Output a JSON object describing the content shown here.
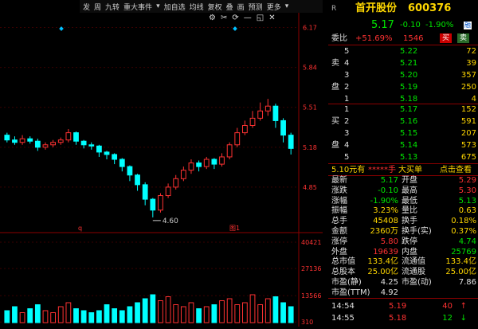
{
  "toolbar": {
    "items": [
      "发",
      "周",
      "九转",
      "重大事件",
      "▾",
      "加自选",
      "均线",
      "复权",
      "叠",
      "画",
      "预测",
      "更多",
      "▾"
    ],
    "icons": [
      "gear-icon",
      "scissors-icon",
      "refresh-icon",
      "minus-icon",
      "window-icon",
      "close-icon"
    ]
  },
  "chart": {
    "price_labels": [
      "6.17",
      "5.84",
      "5.51",
      "5.18",
      "4.85"
    ],
    "volume_labels": [
      "40421",
      "27136",
      "13566",
      "310"
    ],
    "low_label": "4.60",
    "markers": [
      "q",
      "图1"
    ]
  },
  "chart_data": {
    "type": "candlestick",
    "ylim": [
      4.52,
      6.2
    ],
    "candles": [
      [
        5.28,
        5.24,
        5.3,
        5.22
      ],
      [
        5.24,
        5.22,
        5.27,
        5.2
      ],
      [
        5.22,
        5.25,
        5.28,
        5.2
      ],
      [
        5.25,
        5.23,
        5.27,
        5.21
      ],
      [
        5.23,
        5.18,
        5.25,
        5.15
      ],
      [
        5.18,
        5.2,
        5.22,
        5.16
      ],
      [
        5.2,
        5.22,
        5.24,
        5.18
      ],
      [
        5.22,
        5.24,
        5.26,
        5.2
      ],
      [
        5.24,
        5.3,
        5.33,
        5.22
      ],
      [
        5.3,
        5.23,
        5.31,
        5.2
      ],
      [
        5.23,
        5.2,
        5.24,
        5.17
      ],
      [
        5.2,
        5.19,
        5.22,
        5.16
      ],
      [
        5.19,
        5.14,
        5.2,
        5.1
      ],
      [
        5.14,
        5.12,
        5.15,
        5.08
      ],
      [
        5.12,
        5.08,
        5.13,
        5.04
      ],
      [
        5.08,
        5.02,
        5.09,
        4.98
      ],
      [
        5.02,
        4.95,
        5.03,
        4.9
      ],
      [
        4.95,
        4.87,
        4.96,
        4.82
      ],
      [
        4.87,
        4.75,
        4.89,
        4.7
      ],
      [
        4.75,
        4.66,
        4.76,
        4.6
      ],
      [
        4.66,
        4.78,
        4.8,
        4.64
      ],
      [
        4.78,
        4.85,
        4.88,
        4.76
      ],
      [
        4.85,
        4.92,
        4.95,
        4.83
      ],
      [
        4.92,
        4.99,
        5.02,
        4.9
      ],
      [
        4.99,
        5.05,
        5.08,
        4.96
      ],
      [
        5.05,
        5.02,
        5.07,
        4.98
      ],
      [
        5.02,
        5.08,
        5.1,
        5.0
      ],
      [
        5.08,
        5.04,
        5.09,
        5.0
      ],
      [
        5.04,
        5.1,
        5.13,
        5.02
      ],
      [
        5.1,
        5.2,
        5.22,
        5.08
      ],
      [
        5.2,
        5.3,
        5.34,
        5.18
      ],
      [
        5.3,
        5.36,
        5.4,
        5.28
      ],
      [
        5.36,
        5.42,
        5.48,
        5.34
      ],
      [
        5.42,
        5.48,
        5.55,
        5.4
      ],
      [
        5.48,
        5.52,
        5.58,
        5.44
      ],
      [
        5.52,
        5.4,
        5.54,
        5.34
      ],
      [
        5.4,
        5.28,
        5.42,
        5.22
      ],
      [
        5.28,
        5.17,
        5.3,
        5.12
      ]
    ],
    "volumes": [
      6000,
      8000,
      5000,
      7000,
      9000,
      6000,
      5000,
      8000,
      10000,
      7000,
      6000,
      5000,
      6000,
      9000,
      7000,
      6000,
      8000,
      10000,
      12000,
      14000,
      11000,
      13000,
      9000,
      8000,
      10000,
      7000,
      8000,
      9000,
      11000,
      12000,
      9000,
      10000,
      14000,
      9000,
      12000,
      13000,
      10000,
      8000
    ],
    "vol_ylim": [
      0,
      42000
    ]
  },
  "quote": {
    "logo": "R",
    "name": "首开股份",
    "code": "600376",
    "price": "5.17",
    "change": "-0.10",
    "change_pct": "-1.90%",
    "badge": "融",
    "weibi_label": "委比",
    "weibi_value": "+51.69%",
    "weicha_value": "1546",
    "sell_btn": "买",
    "buy_btn": "卖"
  },
  "orderbook": {
    "sell": [
      {
        "level": "5",
        "price": "5.22",
        "vol": "72"
      },
      {
        "level": "4",
        "price": "5.21",
        "vol": "39"
      },
      {
        "level": "3",
        "price": "5.20",
        "vol": "357"
      },
      {
        "level": "2",
        "price": "5.19",
        "vol": "250"
      },
      {
        "level": "1",
        "price": "5.18",
        "vol": "4"
      }
    ],
    "sell_chars": [
      "卖",
      "盘"
    ],
    "buy": [
      {
        "level": "1",
        "price": "5.17",
        "vol": "152"
      },
      {
        "level": "2",
        "price": "5.16",
        "vol": "591"
      },
      {
        "level": "3",
        "price": "5.15",
        "vol": "207"
      },
      {
        "level": "4",
        "price": "5.14",
        "vol": "573"
      },
      {
        "level": "5",
        "price": "5.13",
        "vol": "675"
      }
    ],
    "buy_chars": [
      "买",
      "盘"
    ]
  },
  "banner": {
    "left": "5.10元有",
    "stars": "*****手",
    "mid": "大买单",
    "right": "点击查看"
  },
  "stats": [
    {
      "l1": "最新",
      "v1": "5.17",
      "c1": "green",
      "l2": "开盘",
      "v2": "5.29",
      "c2": "red"
    },
    {
      "l1": "涨跌",
      "v1": "-0.10",
      "c1": "green",
      "l2": "最高",
      "v2": "5.30",
      "c2": "red"
    },
    {
      "l1": "涨幅",
      "v1": "-1.90%",
      "c1": "green",
      "l2": "最低",
      "v2": "5.13",
      "c2": "green"
    },
    {
      "l1": "振幅",
      "v1": "3.23%",
      "c1": "yellow",
      "l2": "量比",
      "v2": "0.63",
      "c2": "yellow"
    },
    {
      "l1": "总手",
      "v1": "45408",
      "c1": "yellow",
      "l2": "换手",
      "v2": "0.18%",
      "c2": "yellow"
    },
    {
      "l1": "金额",
      "v1": "2360万",
      "c1": "yellow",
      "l2": "换手(实)",
      "v2": "0.37%",
      "c2": "yellow"
    },
    {
      "l1": "涨停",
      "v1": "5.80",
      "c1": "red",
      "l2": "跌停",
      "v2": "4.74",
      "c2": "green"
    },
    {
      "l1": "外盘",
      "v1": "19639",
      "c1": "red",
      "l2": "内盘",
      "v2": "25769",
      "c2": "green"
    },
    {
      "l1": "总市值",
      "v1": "133.4亿",
      "c1": "yellow",
      "l2": "流通值",
      "v2": "133.4亿",
      "c2": "yellow"
    },
    {
      "l1": "总股本",
      "v1": "25.00亿",
      "c1": "yellow",
      "l2": "流通股",
      "v2": "25.00亿",
      "c2": "yellow"
    },
    {
      "l1": "市盈(静)",
      "v1": "4.25",
      "c1": "white",
      "l2": "市盈(动)",
      "v2": "7.86",
      "c2": "white"
    },
    {
      "l1": "市盈(TTM)",
      "v1": "4.92",
      "c1": "white",
      "l2": "",
      "v2": "",
      "c2": "white"
    }
  ],
  "ticks": [
    {
      "time": "14:54",
      "price": "5.19",
      "vol": "40",
      "dir": "↑"
    },
    {
      "time": "14:55",
      "price": "5.18",
      "vol": "12",
      "dir": "↓"
    }
  ]
}
